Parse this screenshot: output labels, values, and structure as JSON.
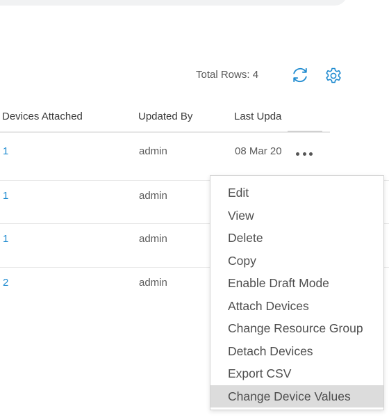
{
  "toolbar": {
    "total_rows": "Total Rows: 4",
    "refresh_icon": "refresh-icon",
    "settings_icon": "gear-icon",
    "accent_color": "#1f8bd0"
  },
  "table": {
    "columns": [
      "Devices Attached",
      "Updated By",
      "Last Upda"
    ],
    "rows": [
      {
        "devices": "1",
        "updated_by": "admin",
        "last_updated": "08 Mar 20"
      },
      {
        "devices": "1",
        "updated_by": "admin",
        "last_updated": ""
      },
      {
        "devices": "1",
        "updated_by": "admin",
        "last_updated": ""
      },
      {
        "devices": "2",
        "updated_by": "admin",
        "last_updated": ""
      }
    ]
  },
  "context_menu": {
    "items": [
      "Edit",
      "View",
      "Delete",
      "Copy",
      "Enable Draft Mode",
      "Attach Devices",
      "Change Resource Group",
      "Detach Devices",
      "Export CSV",
      "Change Device Values"
    ],
    "highlighted": "Change Device Values"
  }
}
